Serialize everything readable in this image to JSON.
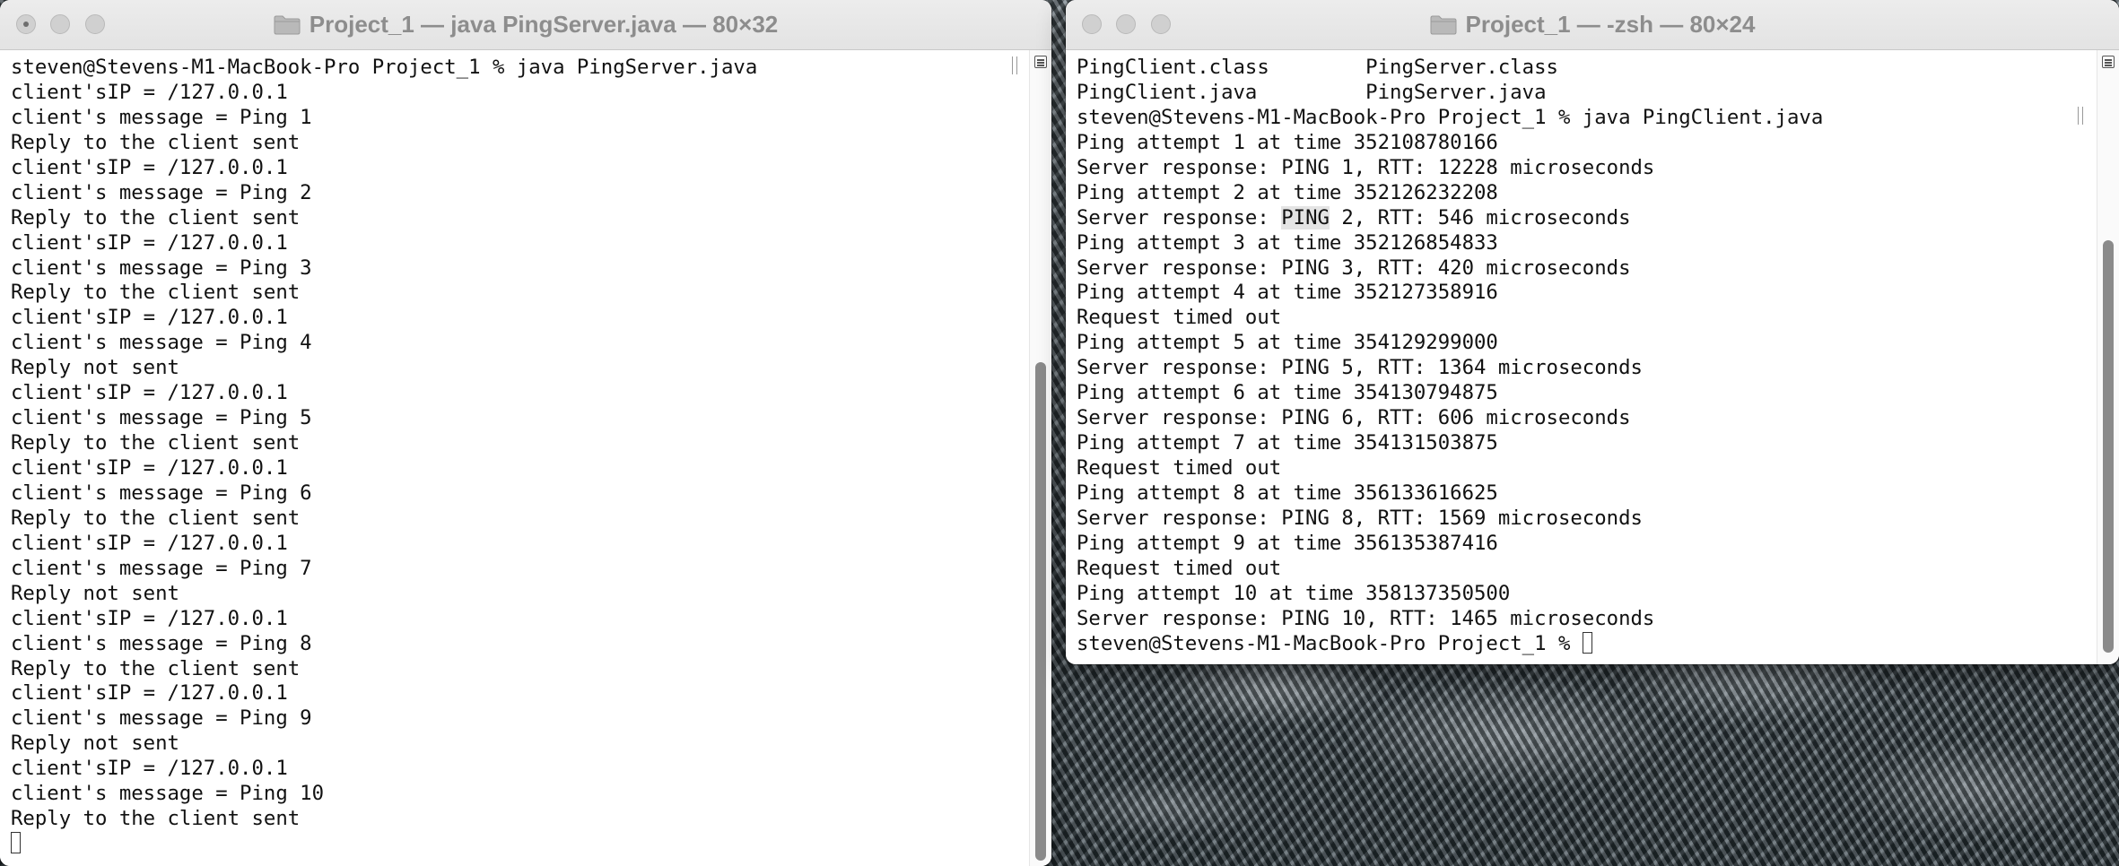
{
  "left_window": {
    "title": "Project_1 — java PingServer.java — 80×32",
    "lines": [
      "steven@Stevens-M1-MacBook-Pro Project_1 % java PingServer.java",
      "client'sIP = /127.0.0.1",
      "client's message = Ping 1",
      "Reply to the client sent",
      "client'sIP = /127.0.0.1",
      "client's message = Ping 2",
      "Reply to the client sent",
      "client'sIP = /127.0.0.1",
      "client's message = Ping 3",
      "Reply to the client sent",
      "client'sIP = /127.0.0.1",
      "client's message = Ping 4",
      "Reply not sent",
      "client'sIP = /127.0.0.1",
      "client's message = Ping 5",
      "Reply to the client sent",
      "client'sIP = /127.0.0.1",
      "client's message = Ping 6",
      "Reply to the client sent",
      "client'sIP = /127.0.0.1",
      "client's message = Ping 7",
      "Reply not sent",
      "client'sIP = /127.0.0.1",
      "client's message = Ping 8",
      "Reply to the client sent",
      "client'sIP = /127.0.0.1",
      "client's message = Ping 9",
      "Reply not sent",
      "client'sIP = /127.0.0.1",
      "client's message = Ping 10",
      "Reply to the client sent"
    ]
  },
  "right_window": {
    "title": "Project_1 — -zsh — 80×24",
    "lines": [
      "PingClient.class        PingServer.class",
      "PingClient.java         PingServer.java",
      "steven@Stevens-M1-MacBook-Pro Project_1 % java PingClient.java",
      "Ping attempt 1 at time 352108780166",
      "Server response: PING 1, RTT: 12228 microseconds",
      "Ping attempt 2 at time 352126232208",
      "Server response: PING 2, RTT: 546 microseconds",
      "Ping attempt 3 at time 352126854833",
      "Server response: PING 3, RTT: 420 microseconds",
      "Ping attempt 4 at time 352127358916",
      "Request timed out",
      "Ping attempt 5 at time 354129299000",
      "Server response: PING 5, RTT: 1364 microseconds",
      "Ping attempt 6 at time 354130794875",
      "Server response: PING 6, RTT: 606 microseconds",
      "Ping attempt 7 at time 354131503875",
      "Request timed out",
      "Ping attempt 8 at time 356133616625",
      "Server response: PING 8, RTT: 1569 microseconds",
      "Ping attempt 9 at time 356135387416",
      "Request timed out",
      "Ping attempt 10 at time 358137350500",
      "Server response: PING 10, RTT: 1465 microseconds"
    ],
    "prompt": "steven@Stevens-M1-MacBook-Pro Project_1 % ",
    "highlight_line_index": 6,
    "highlight_text": "PING"
  },
  "icons": {
    "title_icon": "folder-icon",
    "scroll_marks_icon": "marks-icon",
    "cursor": "terminal-cursor"
  }
}
